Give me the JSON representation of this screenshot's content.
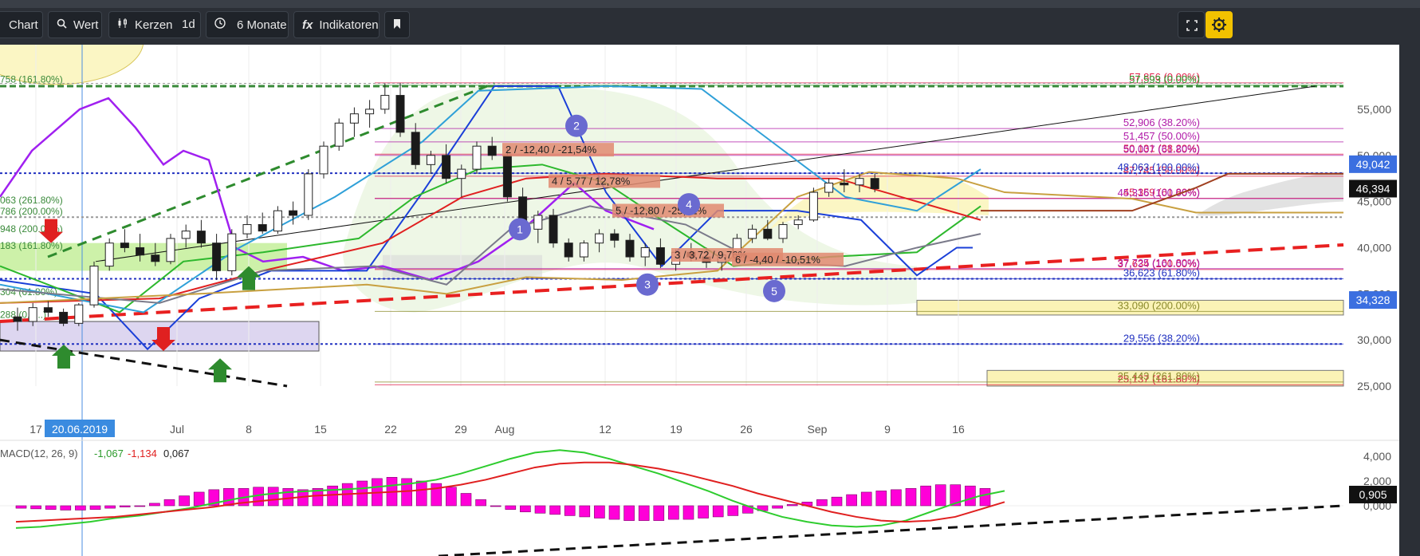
{
  "toolbar": {
    "chart_label": "Chart",
    "wert_label": "Wert",
    "candles_label": "Kerzen",
    "interval_label": "1d",
    "range_label": "6 Monate",
    "indicators_label": "Indikatoren"
  },
  "chart_data": {
    "type": "candlestick",
    "y_axis": {
      "range": [
        25000,
        57500
      ],
      "ticks": [
        "55,000",
        "50,000",
        "45,000",
        "40,000",
        "35,000",
        "30,000",
        "25,000"
      ]
    },
    "x_axis": {
      "ticks": [
        "17",
        "Jul",
        "8",
        "15",
        "22",
        "29",
        "Aug",
        "12",
        "19",
        "26",
        "Sep",
        "9",
        "16"
      ]
    },
    "crosshair_date": "20.06.2019",
    "price_markers": [
      {
        "value": "49,042",
        "color": "#3b6fe0"
      },
      {
        "value": "46,394",
        "color": "#111111"
      },
      {
        "value": "34,328",
        "color": "#3b6fe0"
      }
    ],
    "candles": [
      [
        32500,
        33500,
        31000,
        32000
      ],
      [
        32000,
        34000,
        31500,
        33500
      ],
      [
        33500,
        34200,
        32500,
        33000
      ],
      [
        33000,
        33400,
        31500,
        31800
      ],
      [
        31800,
        34000,
        31500,
        33800
      ],
      [
        33800,
        38500,
        33500,
        38000
      ],
      [
        38000,
        41000,
        37500,
        40500
      ],
      [
        40500,
        42000,
        39500,
        40000
      ],
      [
        40000,
        41500,
        38500,
        39200
      ],
      [
        39200,
        40500,
        38000,
        38500
      ],
      [
        38500,
        41500,
        38200,
        41000
      ],
      [
        41000,
        42500,
        40000,
        41800
      ],
      [
        41800,
        43000,
        40000,
        40500
      ],
      [
        40500,
        41500,
        36500,
        37500
      ],
      [
        37500,
        42000,
        37000,
        41500
      ],
      [
        41500,
        43500,
        41000,
        42500
      ],
      [
        42500,
        43800,
        41500,
        41800
      ],
      [
        41800,
        44500,
        41500,
        44000
      ],
      [
        44000,
        45000,
        42500,
        43500
      ],
      [
        43500,
        48500,
        43000,
        48000
      ],
      [
        48000,
        51500,
        47500,
        51000
      ],
      [
        51000,
        54000,
        50500,
        53500
      ],
      [
        53500,
        55200,
        52000,
        54500
      ],
      [
        54500,
        56000,
        53000,
        55000
      ],
      [
        55000,
        57800,
        54500,
        56500
      ],
      [
        56500,
        57856,
        52000,
        52500
      ],
      [
        52500,
        53500,
        48500,
        49000
      ],
      [
        49000,
        50500,
        48000,
        50000
      ],
      [
        50000,
        51200,
        47000,
        47500
      ],
      [
        47500,
        49000,
        45500,
        48500
      ],
      [
        48500,
        51500,
        48000,
        51000
      ],
      [
        51000,
        52000,
        49500,
        50000
      ],
      [
        50000,
        50800,
        45000,
        45500
      ],
      [
        45500,
        46500,
        41000,
        42000
      ],
      [
        42000,
        44000,
        40500,
        43500
      ],
      [
        43500,
        44200,
        40000,
        40500
      ],
      [
        40500,
        41000,
        38500,
        39000
      ],
      [
        39000,
        40800,
        38500,
        40500
      ],
      [
        40500,
        42000,
        39500,
        41500
      ],
      [
        41500,
        42000,
        40000,
        40800
      ],
      [
        40800,
        41500,
        38500,
        39000
      ],
      [
        39000,
        40500,
        38000,
        40000
      ],
      [
        40000,
        41000,
        37800,
        38200
      ],
      [
        38200,
        39800,
        37500,
        39500
      ],
      [
        39500,
        40500,
        38500,
        39000
      ],
      [
        39000,
        40000,
        37800,
        38400
      ],
      [
        38400,
        39500,
        37500,
        39200
      ],
      [
        39200,
        41500,
        39000,
        41000
      ],
      [
        41000,
        42500,
        40500,
        42000
      ],
      [
        42000,
        43000,
        40800,
        41000
      ],
      [
        41000,
        42800,
        40500,
        42500
      ],
      [
        42500,
        43500,
        42000,
        43000
      ],
      [
        43000,
        46500,
        42800,
        46000
      ],
      [
        46000,
        47500,
        45500,
        47000
      ],
      [
        47000,
        48500,
        46000,
        46800
      ],
      [
        46800,
        48000,
        46000,
        47500
      ],
      [
        47500,
        48000,
        46000,
        46394
      ]
    ],
    "fib_labels": [
      {
        "text": "57,856 (0.00%)",
        "value": 57856,
        "color": "#e0204a"
      },
      {
        "text": "57,593 (0.00%)",
        "value": 57593,
        "color": "#2e9e2e"
      },
      {
        "text": "52,906 (38.20%)",
        "value": 52906,
        "color": "#b01aa8"
      },
      {
        "text": "51,457 (50.00%)",
        "value": 51457,
        "color": "#b01aa8"
      },
      {
        "text": "50,131 (38.20%)",
        "value": 50131,
        "color": "#e0204a"
      },
      {
        "text": "50,007 (61.80%)",
        "value": 50007,
        "color": "#b01aa8"
      },
      {
        "text": "47,745 (50.00%)",
        "value": 47745,
        "color": "#e0204a"
      },
      {
        "text": "48,063 (100.00%)",
        "value": 48063,
        "color": "#2030c0"
      },
      {
        "text": "45,359 (61.80%)",
        "value": 45359,
        "color": "#e0204a"
      },
      {
        "text": "45,316 (100.00%)",
        "value": 45316,
        "color": "#b01aa8"
      },
      {
        "text": "37,634 (100.00%)",
        "value": 37634,
        "color": "#e0204a"
      },
      {
        "text": "37,725 (161.80%)",
        "value": 37725,
        "color": "#b01aa8"
      },
      {
        "text": "36,623 (61.80%)",
        "value": 36623,
        "color": "#2030c0"
      },
      {
        "text": "33,090 (200.00%)",
        "value": 33090,
        "color": "#8a8a2a"
      },
      {
        "text": "29,556 (38.20%)",
        "value": 29556,
        "color": "#2030c0"
      },
      {
        "text": "25,137 (161.80%)",
        "value": 25137,
        "color": "#e0204a"
      },
      {
        "text": "25,443 (261.80%)",
        "value": 25443,
        "color": "#8a8a2a"
      }
    ],
    "left_labels": [
      {
        "text": "758 (161.80%)",
        "value": 57700
      },
      {
        "text": "063 (261.80%)",
        "value": 44600
      },
      {
        "text": "786 (200.00%)",
        "value": 43400
      },
      {
        "text": "948 (200.00%)",
        "value": 41500
      },
      {
        "text": "183 (161.80%)",
        "value": 39700
      },
      {
        "text": "304 (61.80%)",
        "value": 34700
      },
      {
        "text": "288 (0.0...)",
        "value": 32200
      }
    ],
    "measurement_labels": [
      {
        "text": "2 / -12,40 / -21,54%",
        "value": 50400
      },
      {
        "text": "4 / 5,77 / 12,78%",
        "value": 47000
      },
      {
        "text": "5 / -12,80 / -25,72%",
        "value": 43800
      },
      {
        "text": "3 / 3,72 / 9,76%",
        "value": 39000
      },
      {
        "text": "6 / -4,40 / -10,51%",
        "value": 38500
      }
    ],
    "wave_labels": [
      "1",
      "2",
      "3",
      "4",
      "5"
    ],
    "macd": {
      "label": "MACD(12, 26, 9)",
      "macd_value": "-1,067",
      "signal_value": "-1,134",
      "hist_value": "0,067",
      "ticks": [
        "4,000",
        "2,000",
        "0,000"
      ],
      "marker": "0,905",
      "hist": [
        -0.2,
        -0.25,
        -0.3,
        -0.35,
        -0.35,
        -0.3,
        -0.2,
        -0.1,
        0,
        0.2,
        0.5,
        0.8,
        1.1,
        1.3,
        1.4,
        1.4,
        1.5,
        1.5,
        1.4,
        1.3,
        1.4,
        1.6,
        1.8,
        2.0,
        2.2,
        2.3,
        2.2,
        2.0,
        1.8,
        1.5,
        1.0,
        0.5,
        0,
        -0.3,
        -0.5,
        -0.6,
        -0.7,
        -0.8,
        -0.9,
        -1.0,
        -1.1,
        -1.2,
        -1.2,
        -1.2,
        -1.1,
        -1.1,
        -1.0,
        -0.9,
        -0.8,
        -0.6,
        -0.4,
        -0.2,
        0.1,
        0.3,
        0.5,
        0.7,
        0.9,
        1.1,
        1.2,
        1.3,
        1.4,
        1.6,
        1.7,
        1.7,
        1.6,
        1.4
      ],
      "macd_line": [
        -1.8,
        -1.7,
        -1.5,
        -1.3,
        -1.0,
        -0.8,
        -0.5,
        -0.2,
        0.2,
        0.6,
        0.9,
        1.1,
        1.2,
        1.3,
        1.4,
        1.6,
        1.8,
        2.1,
        2.6,
        3.2,
        3.8,
        4.3,
        4.5,
        4.3,
        3.8,
        3.2,
        2.6,
        1.9,
        1.2,
        0.4,
        -0.3,
        -0.9,
        -1.3,
        -1.6,
        -1.7,
        -1.6,
        -1.2,
        -0.5,
        0.2,
        0.8,
        1.2
      ],
      "signal_line": [
        -1.3,
        -1.2,
        -1.1,
        -1.0,
        -0.9,
        -0.7,
        -0.5,
        -0.3,
        -0.1,
        0.2,
        0.4,
        0.6,
        0.8,
        0.9,
        1.0,
        1.1,
        1.2,
        1.4,
        1.7,
        2.1,
        2.6,
        3.1,
        3.4,
        3.5,
        3.5,
        3.3,
        3.0,
        2.6,
        2.1,
        1.6,
        1.0,
        0.5,
        0.0,
        -0.5,
        -0.9,
        -1.2,
        -1.3,
        -1.2,
        -0.9,
        -0.3,
        0.3
      ]
    }
  }
}
